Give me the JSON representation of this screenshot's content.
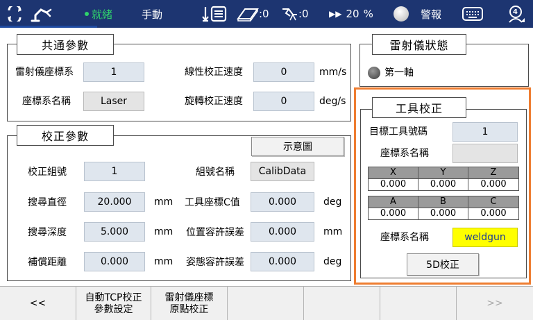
{
  "topbar": {
    "status": "就緒",
    "mode": "手動",
    "user_frame_value": ":0",
    "tool_frame_value": ":0",
    "speed": "20",
    "speed_unit": "%",
    "alarm": "警報",
    "badge_count": "4",
    "colors": {
      "background": "#1d3571",
      "status": "#2fd36b"
    }
  },
  "common": {
    "title": "共通參數",
    "laser_frame_label": "雷射儀座標系",
    "laser_frame_value": "1",
    "frame_name_label": "座標系名稱",
    "frame_name_value": "Laser",
    "linear_speed_label": "線性校正速度",
    "linear_speed_value": "0",
    "linear_speed_unit": "mm/s",
    "rot_speed_label": "旋轉校正速度",
    "rot_speed_value": "0",
    "rot_speed_unit": "deg/s"
  },
  "calib": {
    "title": "校正參數",
    "diagram_button": "示意圖",
    "group_no_label": "校正組號",
    "group_no_value": "1",
    "group_name_label": "組號名稱",
    "group_name_value": "CalibData",
    "search_dia_label": "搜尋直徑",
    "search_dia_value": "20.000",
    "search_dia_unit": "mm",
    "tool_c_label": "工具座標C值",
    "tool_c_value": "0.000",
    "tool_c_unit": "deg",
    "search_depth_label": "搜尋深度",
    "search_depth_value": "5.000",
    "search_depth_unit": "mm",
    "pos_tol_label": "位置容許誤差",
    "pos_tol_value": "0.000",
    "pos_tol_unit": "mm",
    "comp_dist_label": "補償距離",
    "comp_dist_value": "0.000",
    "comp_dist_unit": "mm",
    "pose_tol_label": "姿態容許誤差",
    "pose_tol_value": "0.000",
    "pose_tol_unit": "deg"
  },
  "laser_status": {
    "title": "雷射儀狀態",
    "axis1_label": "第一軸"
  },
  "tool_calib": {
    "title": "工具校正",
    "target_tool_label": "目標工具號碼",
    "target_tool_value": "1",
    "frame_name_label": "座標系名稱",
    "frame_name_value": "",
    "coords_top": {
      "headers": [
        "X",
        "Y",
        "Z"
      ],
      "values": [
        "0.000",
        "0.000",
        "0.000"
      ]
    },
    "coords_bottom": {
      "headers": [
        "A",
        "B",
        "C"
      ],
      "values": [
        "0.000",
        "0.000",
        "0.000"
      ]
    },
    "result_frame_label": "座標系名稱",
    "result_frame_value": "weldgun",
    "calib_5d_button": "5D校正"
  },
  "bottombar": {
    "prev": "<<",
    "auto_tcp_line1": "自動TCP校正",
    "auto_tcp_line2": "參數設定",
    "laser_origin_line1": "雷射儀座標",
    "laser_origin_line2": "原點校正",
    "next": ">>"
  }
}
